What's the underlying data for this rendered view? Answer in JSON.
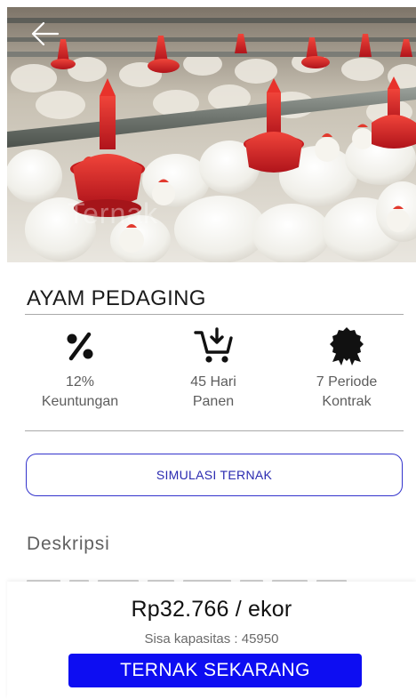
{
  "hero": {
    "watermark": "Ternak"
  },
  "product": {
    "title": "AYAM PEDAGING"
  },
  "stats": [
    {
      "icon": "percent-icon",
      "value": "12%",
      "label": "Keuntungan"
    },
    {
      "icon": "cart-icon",
      "value": "45 Hari",
      "label": "Panen"
    },
    {
      "icon": "award-icon",
      "value": "7 Periode",
      "label": "Kontrak"
    }
  ],
  "actions": {
    "simulate_label": "SIMULASI TERNAK",
    "cta_label": "TERNAK SEKARANG"
  },
  "description": {
    "heading": "Deskripsi"
  },
  "pricing": {
    "price": "Rp32.766 / ekor",
    "capacity": "Sisa kapasitas : 45950"
  },
  "colors": {
    "primary": "#0d0df2",
    "outline": "#3333cc",
    "feeder_red": "#d81f1f"
  }
}
